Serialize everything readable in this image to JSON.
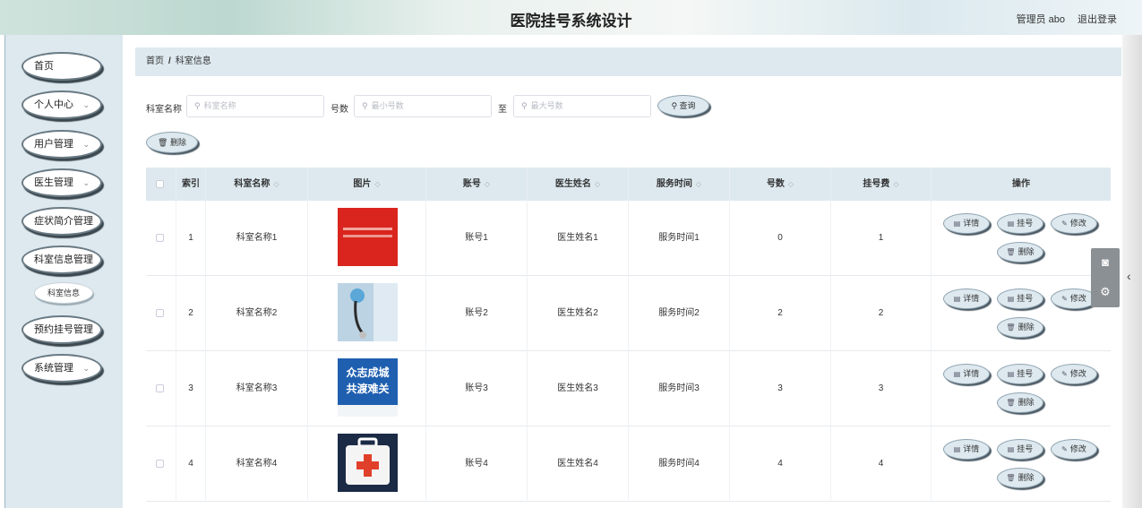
{
  "header": {
    "title": "医院挂号系统设计",
    "admin": "管理员 abo",
    "logout": "退出登录"
  },
  "sidebar": {
    "items": [
      {
        "label": "首页",
        "has_arrow": false
      },
      {
        "label": "个人中心",
        "has_arrow": true
      },
      {
        "label": "用户管理",
        "has_arrow": true
      },
      {
        "label": "医生管理",
        "has_arrow": true
      },
      {
        "label": "症状简介管理",
        "has_arrow": false
      },
      {
        "label": "科室信息管理",
        "has_arrow": false
      },
      {
        "label": "预约挂号管理",
        "has_arrow": false
      },
      {
        "label": "系统管理",
        "has_arrow": true
      }
    ],
    "submenu": {
      "label": "科室信息"
    }
  },
  "breadcrumb": {
    "home": "首页",
    "separator": "/",
    "current": "科室信息"
  },
  "search": {
    "name_label": "科室名称",
    "name_placeholder": "科室名称",
    "number_label": "号数",
    "min_placeholder": "最小号数",
    "to_label": "至",
    "max_placeholder": "最大号数",
    "query_button": "查询",
    "delete_button": "删除"
  },
  "table": {
    "headers": [
      "索引",
      "科室名称",
      "图片",
      "账号",
      "医生姓名",
      "服务时间",
      "号数",
      "挂号费",
      "操作"
    ],
    "rows": [
      {
        "index": "1",
        "name": "科室名称1",
        "account": "账号1",
        "doctor": "医生姓名1",
        "time": "服务时间1",
        "count": "0",
        "fee": "1",
        "image": "red-banner"
      },
      {
        "index": "2",
        "name": "科室名称2",
        "account": "账号2",
        "doctor": "医生姓名2",
        "time": "服务时间2",
        "count": "2",
        "fee": "2",
        "image": "stethoscope"
      },
      {
        "index": "3",
        "name": "科室名称3",
        "account": "账号3",
        "doctor": "医生姓名3",
        "time": "服务时间3",
        "count": "3",
        "fee": "3",
        "image": "blue-poster"
      },
      {
        "index": "4",
        "name": "科室名称4",
        "account": "账号4",
        "doctor": "医生姓名4",
        "time": "服务时间4",
        "count": "4",
        "fee": "4",
        "image": "first-aid-kit"
      }
    ],
    "actions": {
      "detail": "详情",
      "register": "挂号",
      "edit": "修改",
      "delete": "删除"
    }
  },
  "poster_text": {
    "line1": "众志成城",
    "line2": "共渡难关"
  },
  "colors": {
    "accent_bg": "#dde9ef",
    "red": "#d9251d",
    "navy": "#1b2a45"
  }
}
